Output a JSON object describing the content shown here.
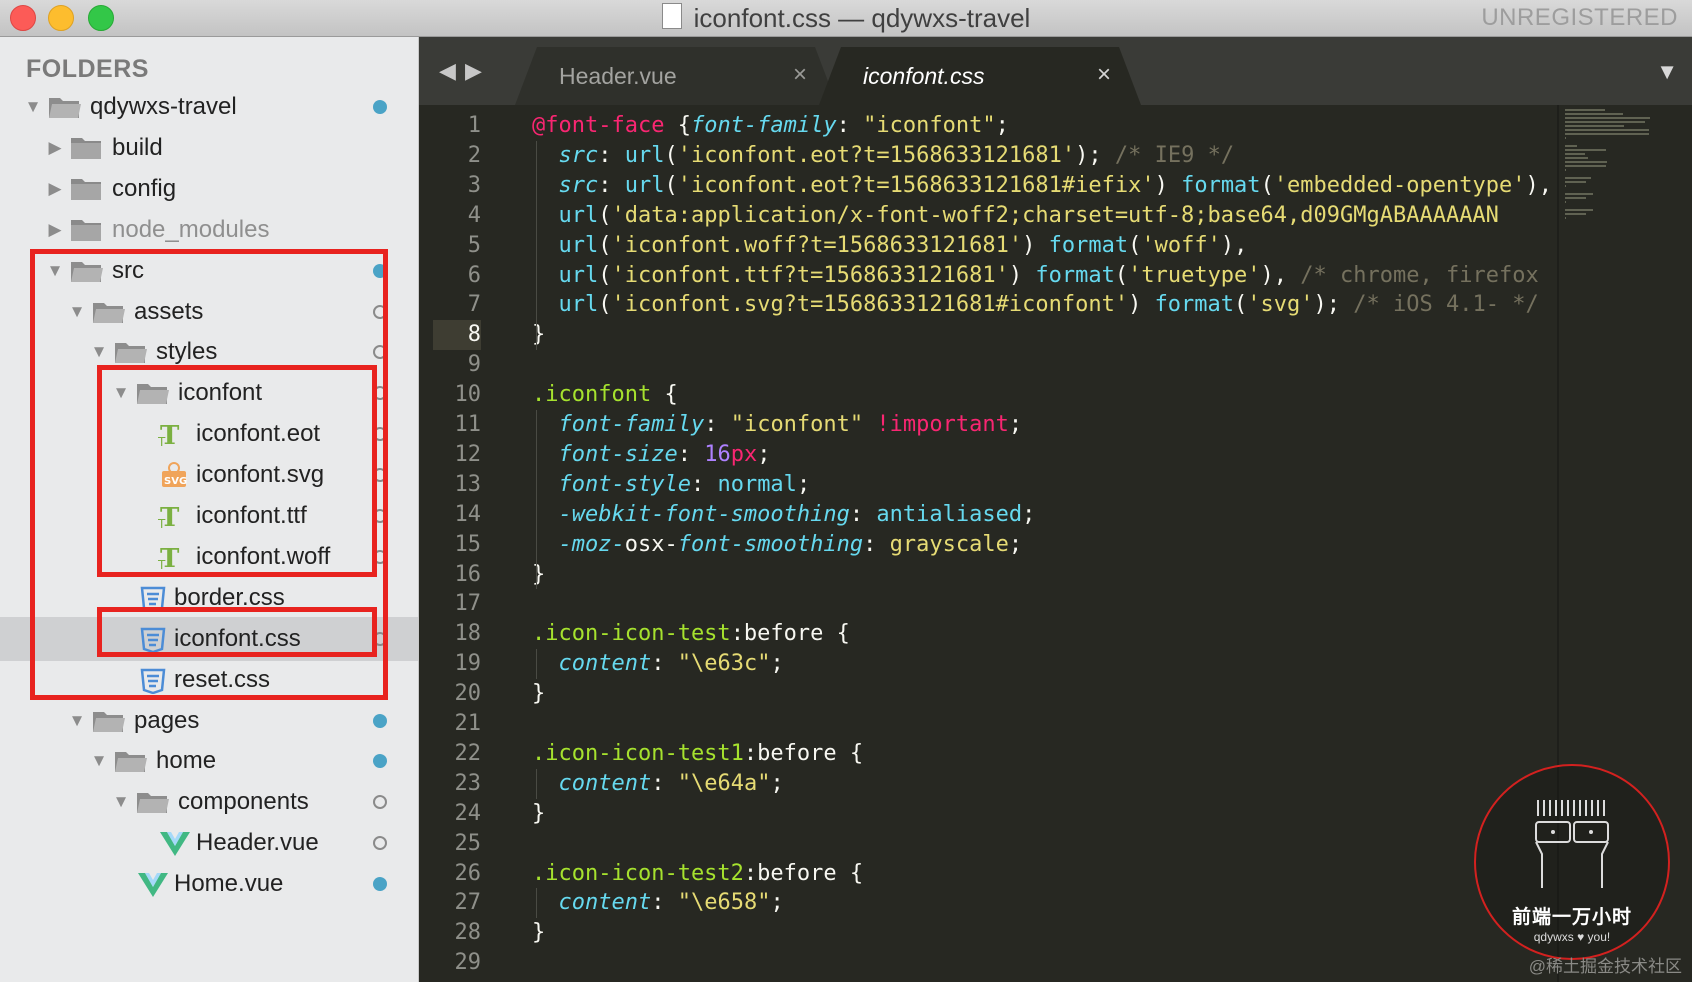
{
  "window": {
    "title": "iconfont.css — qdywxs-travel",
    "license_status": "UNREGISTERED"
  },
  "sidebar": {
    "header": "FOLDERS",
    "items": [
      {
        "label": "qdywxs-travel",
        "depth": 0,
        "expanded": true,
        "type": "folder",
        "status": "modified"
      },
      {
        "label": "build",
        "depth": 1,
        "expanded": false,
        "type": "folder",
        "status": "none"
      },
      {
        "label": "config",
        "depth": 1,
        "expanded": false,
        "type": "folder",
        "status": "none"
      },
      {
        "label": "node_modules",
        "depth": 1,
        "expanded": false,
        "type": "folder",
        "status": "none",
        "dimmed": true
      },
      {
        "label": "src",
        "depth": 1,
        "expanded": true,
        "type": "folder",
        "status": "modified"
      },
      {
        "label": "assets",
        "depth": 2,
        "expanded": true,
        "type": "folder",
        "status": "untracked"
      },
      {
        "label": "styles",
        "depth": 3,
        "expanded": true,
        "type": "folder",
        "status": "untracked"
      },
      {
        "label": "iconfont",
        "depth": 4,
        "expanded": true,
        "type": "folder",
        "status": "untracked"
      },
      {
        "label": "iconfont.eot",
        "depth": 5,
        "type": "font-file",
        "status": "untracked"
      },
      {
        "label": "iconfont.svg",
        "depth": 5,
        "type": "svg-file",
        "status": "untracked"
      },
      {
        "label": "iconfont.ttf",
        "depth": 5,
        "type": "font-file",
        "status": "untracked"
      },
      {
        "label": "iconfont.woff",
        "depth": 5,
        "type": "font-file",
        "status": "untracked"
      },
      {
        "label": "border.css",
        "depth": 4,
        "type": "css-file",
        "status": "none"
      },
      {
        "label": "iconfont.css",
        "depth": 4,
        "type": "css-file",
        "status": "untracked",
        "selected": true
      },
      {
        "label": "reset.css",
        "depth": 4,
        "type": "css-file",
        "status": "none"
      },
      {
        "label": "pages",
        "depth": 2,
        "expanded": true,
        "type": "folder",
        "status": "modified"
      },
      {
        "label": "home",
        "depth": 3,
        "expanded": true,
        "type": "folder",
        "status": "modified"
      },
      {
        "label": "components",
        "depth": 4,
        "expanded": true,
        "type": "folder",
        "status": "untracked"
      },
      {
        "label": "Header.vue",
        "depth": 5,
        "type": "vue-file",
        "status": "untracked"
      },
      {
        "label": "Home.vue",
        "depth": 4,
        "type": "vue-file",
        "status": "modified"
      }
    ]
  },
  "tabs": [
    {
      "label": "Header.vue",
      "active": false,
      "close": "×"
    },
    {
      "label": "iconfont.css",
      "active": true,
      "close": "×"
    }
  ],
  "editor": {
    "active_line": 8,
    "line_numbers": [
      "1",
      "2",
      "3",
      "4",
      "5",
      "6",
      "7",
      "8",
      "9",
      "10",
      "11",
      "12",
      "13",
      "14",
      "15",
      "16",
      "17",
      "18",
      "19",
      "20",
      "21",
      "22",
      "23",
      "24",
      "25",
      "26",
      "27",
      "28",
      "29"
    ],
    "lines": [
      [
        [
          "at",
          "@font-face"
        ],
        [
          "punc",
          " {"
        ],
        [
          "prop",
          "font-family"
        ],
        [
          "punc",
          ": "
        ],
        [
          "str",
          "\"iconfont\""
        ],
        [
          "punc",
          ";"
        ]
      ],
      [
        [
          "punc",
          "  "
        ],
        [
          "prop",
          "src"
        ],
        [
          "punc",
          ": "
        ],
        [
          "fn",
          "url"
        ],
        [
          "punc",
          "("
        ],
        [
          "str",
          "'iconfont.eot?t=1568633121681'"
        ],
        [
          "punc",
          ");"
        ],
        [
          "punc",
          " "
        ],
        [
          "com",
          "/* IE9 */"
        ]
      ],
      [
        [
          "punc",
          "  "
        ],
        [
          "prop",
          "src"
        ],
        [
          "punc",
          ": "
        ],
        [
          "fn",
          "url"
        ],
        [
          "punc",
          "("
        ],
        [
          "str",
          "'iconfont.eot?t=1568633121681#iefix'"
        ],
        [
          "punc",
          ") "
        ],
        [
          "fn",
          "format"
        ],
        [
          "punc",
          "("
        ],
        [
          "str",
          "'embedded-opentype'"
        ],
        [
          "punc",
          "),"
        ]
      ],
      [
        [
          "punc",
          "  "
        ],
        [
          "fn",
          "url"
        ],
        [
          "punc",
          "("
        ],
        [
          "str",
          "'data:application/x-font-woff2;charset=utf-8;base64,d09GMgABAAAAAAN"
        ]
      ],
      [
        [
          "punc",
          "  "
        ],
        [
          "fn",
          "url"
        ],
        [
          "punc",
          "("
        ],
        [
          "str",
          "'iconfont.woff?t=1568633121681'"
        ],
        [
          "punc",
          ") "
        ],
        [
          "fn",
          "format"
        ],
        [
          "punc",
          "("
        ],
        [
          "str",
          "'woff'"
        ],
        [
          "punc",
          "),"
        ]
      ],
      [
        [
          "punc",
          "  "
        ],
        [
          "fn",
          "url"
        ],
        [
          "punc",
          "("
        ],
        [
          "str",
          "'iconfont.ttf?t=1568633121681'"
        ],
        [
          "punc",
          ") "
        ],
        [
          "fn",
          "format"
        ],
        [
          "punc",
          "("
        ],
        [
          "str",
          "'truetype'"
        ],
        [
          "punc",
          "), "
        ],
        [
          "com",
          "/* chrome, firefox"
        ]
      ],
      [
        [
          "punc",
          "  "
        ],
        [
          "fn",
          "url"
        ],
        [
          "punc",
          "("
        ],
        [
          "str",
          "'iconfont.svg?t=1568633121681#iconfont'"
        ],
        [
          "punc",
          ") "
        ],
        [
          "fn",
          "format"
        ],
        [
          "punc",
          "("
        ],
        [
          "str",
          "'svg'"
        ],
        [
          "punc",
          "); "
        ],
        [
          "com",
          "/* iOS 4.1- */"
        ]
      ],
      [
        [
          "punc",
          "}"
        ]
      ],
      [],
      [
        [
          "sel",
          ".iconfont"
        ],
        [
          "punc",
          " {"
        ]
      ],
      [
        [
          "punc",
          "  "
        ],
        [
          "prop",
          "font-family"
        ],
        [
          "punc",
          ": "
        ],
        [
          "str",
          "\"iconfont\""
        ],
        [
          "punc",
          " "
        ],
        [
          "imp",
          "!important"
        ],
        [
          "punc",
          ";"
        ]
      ],
      [
        [
          "punc",
          "  "
        ],
        [
          "prop",
          "font-size"
        ],
        [
          "punc",
          ": "
        ],
        [
          "num",
          "16"
        ],
        [
          "unit",
          "px"
        ],
        [
          "punc",
          ";"
        ]
      ],
      [
        [
          "punc",
          "  "
        ],
        [
          "prop",
          "font-style"
        ],
        [
          "punc",
          ": "
        ],
        [
          "val",
          "normal"
        ],
        [
          "punc",
          ";"
        ]
      ],
      [
        [
          "punc",
          "  "
        ],
        [
          "prop",
          "-webkit-font-smoothing"
        ],
        [
          "punc",
          ": "
        ],
        [
          "val",
          "antialiased"
        ],
        [
          "punc",
          ";"
        ]
      ],
      [
        [
          "punc",
          "  "
        ],
        [
          "prop",
          "-moz-"
        ],
        [
          "punc",
          "osx-"
        ],
        [
          "prop",
          "font-smoothing"
        ],
        [
          "punc",
          ": "
        ],
        [
          "str",
          "grayscale"
        ],
        [
          "punc",
          ";"
        ]
      ],
      [
        [
          "punc",
          "}"
        ]
      ],
      [],
      [
        [
          "sel",
          ".icon-icon-test"
        ],
        [
          "punc",
          ":before {"
        ]
      ],
      [
        [
          "punc",
          "  "
        ],
        [
          "prop",
          "content"
        ],
        [
          "punc",
          ": "
        ],
        [
          "str",
          "\"\\e63c\""
        ],
        [
          "punc",
          ";"
        ]
      ],
      [
        [
          "punc",
          "}"
        ]
      ],
      [],
      [
        [
          "sel",
          ".icon-icon-test1"
        ],
        [
          "punc",
          ":before {"
        ]
      ],
      [
        [
          "punc",
          "  "
        ],
        [
          "prop",
          "content"
        ],
        [
          "punc",
          ": "
        ],
        [
          "str",
          "\"\\e64a\""
        ],
        [
          "punc",
          ";"
        ]
      ],
      [
        [
          "punc",
          "}"
        ]
      ],
      [],
      [
        [
          "sel",
          ".icon-icon-test2"
        ],
        [
          "punc",
          ":before {"
        ]
      ],
      [
        [
          "punc",
          "  "
        ],
        [
          "prop",
          "content"
        ],
        [
          "punc",
          ": "
        ],
        [
          "str",
          "\"\\e658\""
        ],
        [
          "punc",
          ";"
        ]
      ],
      [
        [
          "punc",
          "}"
        ]
      ],
      []
    ]
  },
  "watermark": {
    "title": "前端一万小时",
    "subtitle": "qdywxs ♥ you!",
    "site": "@稀土掘金技术社区"
  },
  "colors": {
    "highlight_box": "#e8231f",
    "status_modified": "#4aa3c6",
    "editor_bg": "#272822"
  }
}
